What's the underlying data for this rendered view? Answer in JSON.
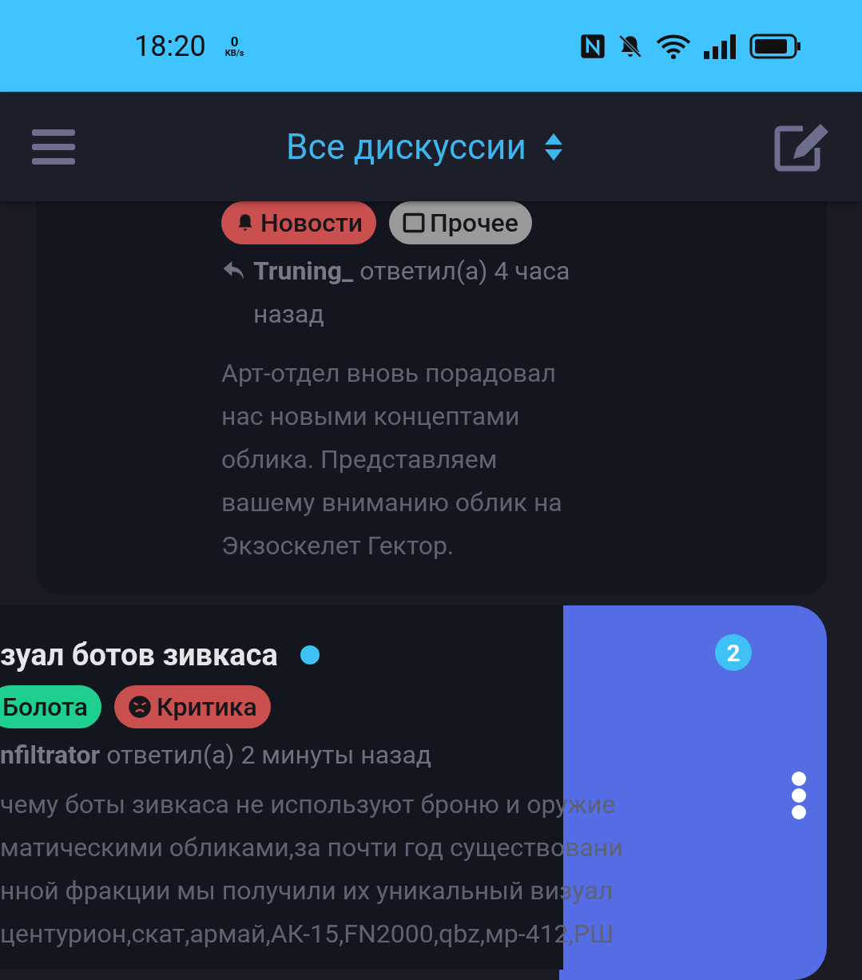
{
  "status_bar": {
    "time": "18:20",
    "speed_value": "0",
    "speed_unit": "KB/s"
  },
  "header": {
    "title": "Все дискуссии"
  },
  "discussions": [
    {
      "tags": [
        {
          "label": "Новости",
          "kind": "bell",
          "color": "#c9504f"
        },
        {
          "label": "Прочее",
          "kind": "box",
          "color": "#9a9a9a"
        }
      ],
      "meta": "**Truning_** ответил(а) 4 часа назад",
      "reply_icon": true,
      "excerpt": [
        "Арт-отдел вновь порадовал",
        "нас новыми концептами",
        "облика. Представляем",
        "вашему вниманию облик на",
        "Экзоскелет Гектор."
      ],
      "swiped": false
    },
    {
      "title": "зуал ботов зивкаса",
      "unread": true,
      "swiped": true,
      "badge": "2",
      "tags": [
        {
          "label": "Болота",
          "kind": "none",
          "color": "#1fcf8f"
        },
        {
          "label": "Критика",
          "kind": "angry",
          "color": "#c9504f"
        }
      ],
      "meta": "**nfiltrator** ответил(а) 2 минуты назад",
      "reply_icon": false,
      "excerpt": [
        "чему боты зивкаса не используют броню и оружие",
        "матическими обликами,за почти год существовани",
        "нной фракции мы получили их уникальный визуал",
        "центурион,скат,армай,АК-15,FN2000,qbz,мр-412,РШ"
      ]
    }
  ]
}
